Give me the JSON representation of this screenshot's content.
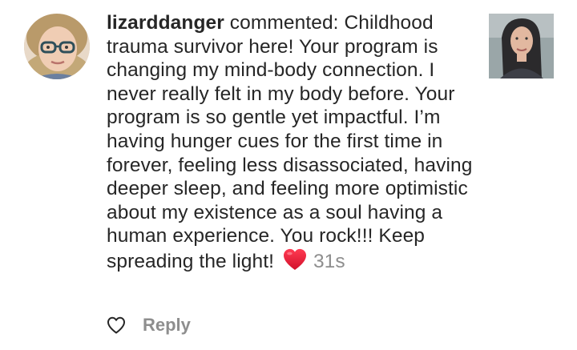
{
  "comment": {
    "username": "lizarddanger",
    "action_text": " commented: ",
    "text": "Childhood trauma survivor here! Your program is changing my mind-body connection. I never really felt in my body before. Your program is so gentle yet impactful. I’m having hunger cues for the first time in forever, feeling less disassociated, having deeper sleep, and feeling more optimistic about my existence as a soul having a human experience. You rock!!! Keep spreading the light!",
    "timestamp": "31s"
  },
  "actions": {
    "reply_label": "Reply"
  },
  "icons": {
    "reaction": "red-heart-emoji",
    "like": "heart-outline-icon"
  },
  "colors": {
    "text": "#262626",
    "muted": "#8e8e8e",
    "heart": "#e0245e"
  }
}
